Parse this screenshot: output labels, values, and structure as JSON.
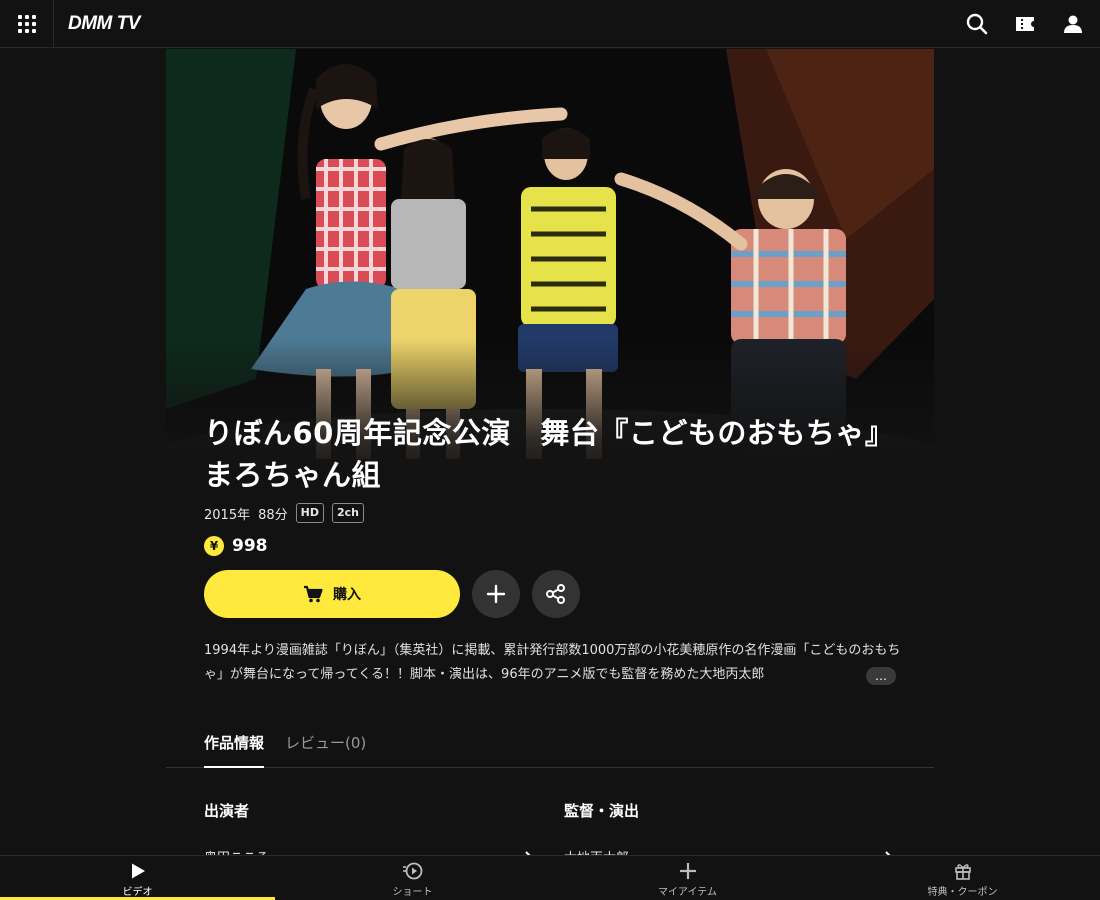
{
  "header": {
    "logo": "DMM TV",
    "icons": [
      "search-icon",
      "ticket-icon",
      "user-icon"
    ]
  },
  "work": {
    "title": "りぼん60周年記念公演　舞台『こどものおもちゃ』まろちゃん組",
    "year": "2015年",
    "duration": "88分",
    "badges": [
      "HD",
      "2ch"
    ],
    "currency_symbol": "¥",
    "price": "998",
    "buy_label": "購入",
    "description": "1994年より漫画雑誌「りぼん」（集英社）に掲載、累計発行部数1000万部の小花美穂原作の名作漫画「こどものおもちゃ」が舞台になって帰ってくる！！脚本・演出は、96年のアニメ版でも監督を務めた大地丙太郎",
    "more_label": "…"
  },
  "tabs": [
    {
      "label": "作品情報",
      "active": true
    },
    {
      "label": "レビュー(0)",
      "active": false
    }
  ],
  "credits": [
    {
      "heading": "出演者",
      "first": "奥田こころ"
    },
    {
      "heading": "監督・演出",
      "first": "大地丙太郎"
    }
  ],
  "bottom_nav": [
    {
      "label": "ビデオ",
      "icon": "play-icon",
      "active": true
    },
    {
      "label": "ショート",
      "icon": "short-play-icon",
      "active": false
    },
    {
      "label": "マイアイテム",
      "icon": "plus-icon",
      "active": false
    },
    {
      "label": "特典・クーポン",
      "icon": "gift-icon",
      "active": false
    }
  ],
  "colors": {
    "background": "#121212",
    "accent": "#ffe93d"
  }
}
